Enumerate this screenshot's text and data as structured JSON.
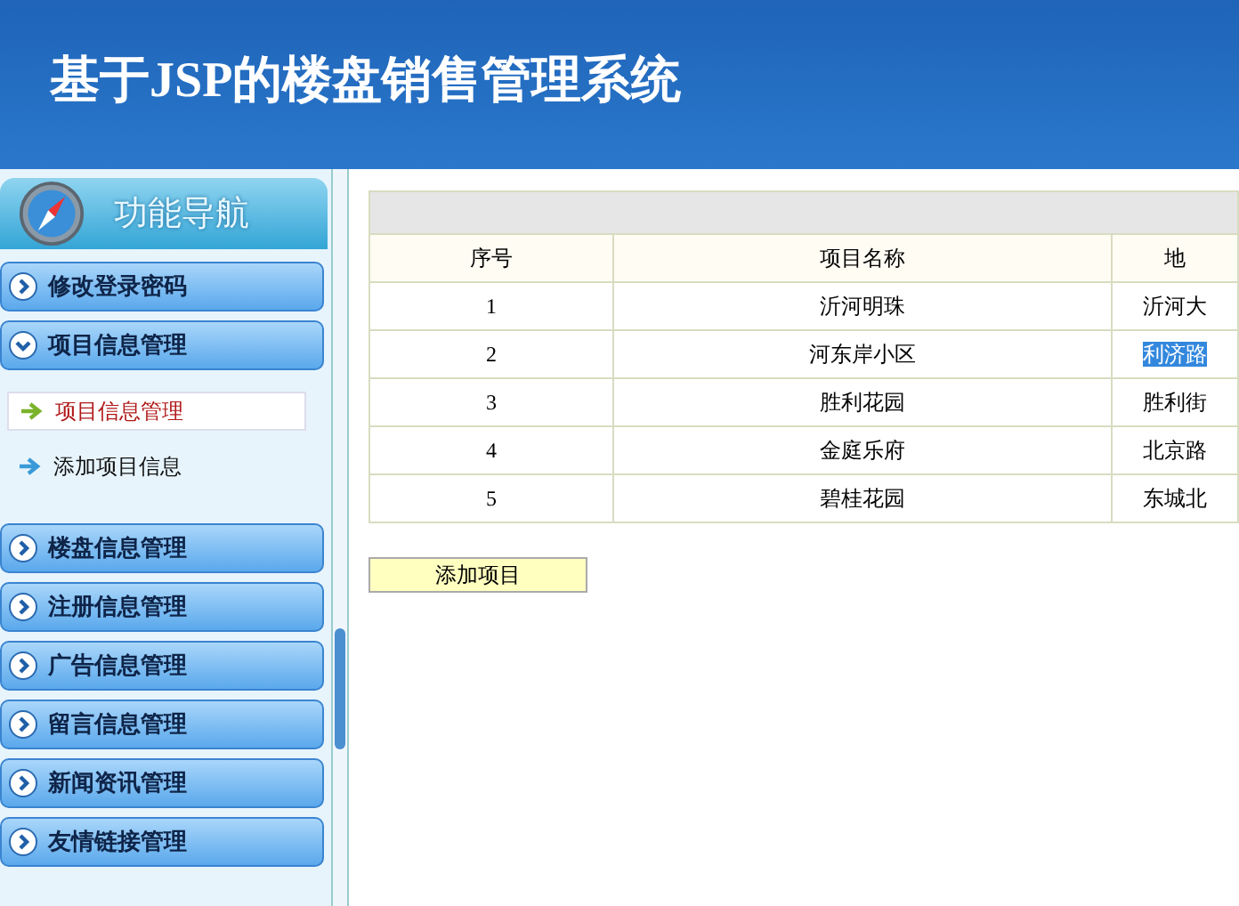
{
  "header": {
    "title": "基于JSP的楼盘销售管理系统"
  },
  "sidebar": {
    "title": "功能导航",
    "items": [
      {
        "label": "修改登录密码",
        "expanded": false
      },
      {
        "label": "项目信息管理",
        "expanded": true,
        "children": [
          {
            "label": "项目信息管理",
            "selected": true
          },
          {
            "label": "添加项目信息",
            "selected": false
          }
        ]
      },
      {
        "label": "楼盘信息管理",
        "expanded": false
      },
      {
        "label": "注册信息管理",
        "expanded": false
      },
      {
        "label": "广告信息管理",
        "expanded": false
      },
      {
        "label": "留言信息管理",
        "expanded": false
      },
      {
        "label": "新闻资讯管理",
        "expanded": false
      },
      {
        "label": "友情链接管理",
        "expanded": false
      }
    ]
  },
  "table": {
    "columns": [
      "序号",
      "项目名称",
      "地"
    ],
    "rows": [
      {
        "cells": [
          "1",
          "沂河明珠",
          "沂河大"
        ],
        "highlighted": false
      },
      {
        "cells": [
          "2",
          "河东岸小区",
          "利济路"
        ],
        "highlighted": true
      },
      {
        "cells": [
          "3",
          "胜利花园",
          "胜利街"
        ],
        "highlighted": false
      },
      {
        "cells": [
          "4",
          "金庭乐府",
          "北京路"
        ],
        "highlighted": false
      },
      {
        "cells": [
          "5",
          "碧桂花园",
          "东城北"
        ],
        "highlighted": false
      }
    ]
  },
  "add_button": "添加项目"
}
